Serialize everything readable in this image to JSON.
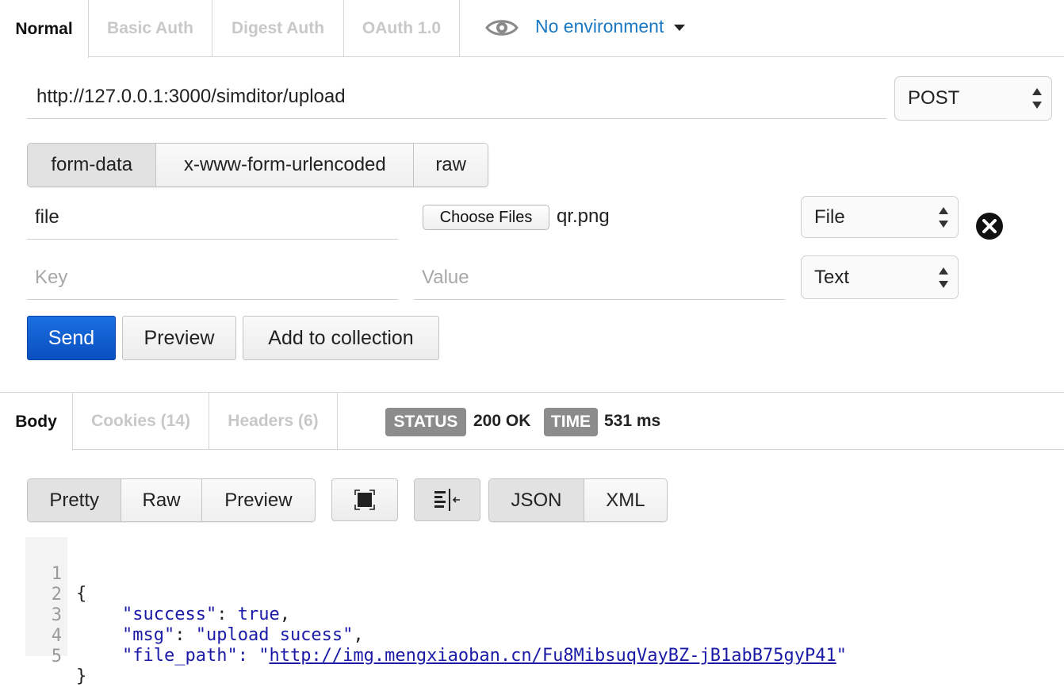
{
  "auth_tabs": [
    "Normal",
    "Basic Auth",
    "Digest Auth",
    "OAuth 1.0"
  ],
  "environment": {
    "label": "No environment",
    "icon": "eye-icon"
  },
  "request": {
    "url": "http://127.0.0.1:3000/simditor/upload",
    "method": "POST"
  },
  "body_types": [
    "form-data",
    "x-www-form-urlencoded",
    "raw"
  ],
  "form_rows": [
    {
      "key": "file",
      "choose_label": "Choose Files",
      "file_name": "qr.png",
      "type": "File"
    },
    {
      "key_placeholder": "Key",
      "value_placeholder": "Value",
      "type": "Text"
    }
  ],
  "actions": {
    "send": "Send",
    "preview": "Preview",
    "add_to_collection": "Add to collection"
  },
  "response_tabs": [
    "Body",
    "Cookies (14)",
    "Headers (6)"
  ],
  "status": {
    "status_label": "STATUS",
    "status_value": "200 OK",
    "time_label": "TIME",
    "time_value": "531 ms"
  },
  "view_modes": [
    "Pretty",
    "Raw",
    "Preview"
  ],
  "formats": [
    "JSON",
    "XML"
  ],
  "code_lines": [
    {
      "n": "1",
      "text": "{"
    },
    {
      "n": "2",
      "key": "\"success\"",
      "sep": ": ",
      "val": "true",
      "end": ","
    },
    {
      "n": "3",
      "key": "\"msg\"",
      "sep": ": ",
      "val": "\"upload sucess\"",
      "end": ","
    },
    {
      "n": "4",
      "key": "\"file_path\"",
      "sep": ": \"",
      "link": "http://img.mengxiaoban.cn/Fu8MibsuqVayBZ-jB1abB75gyP41",
      "end": "\""
    },
    {
      "n": "5",
      "text": "}"
    }
  ],
  "colors": {
    "primary": "#0a4fc0",
    "link": "#1a78c2",
    "code_key": "#1a1aa6",
    "badge": "#8c8c8c"
  }
}
